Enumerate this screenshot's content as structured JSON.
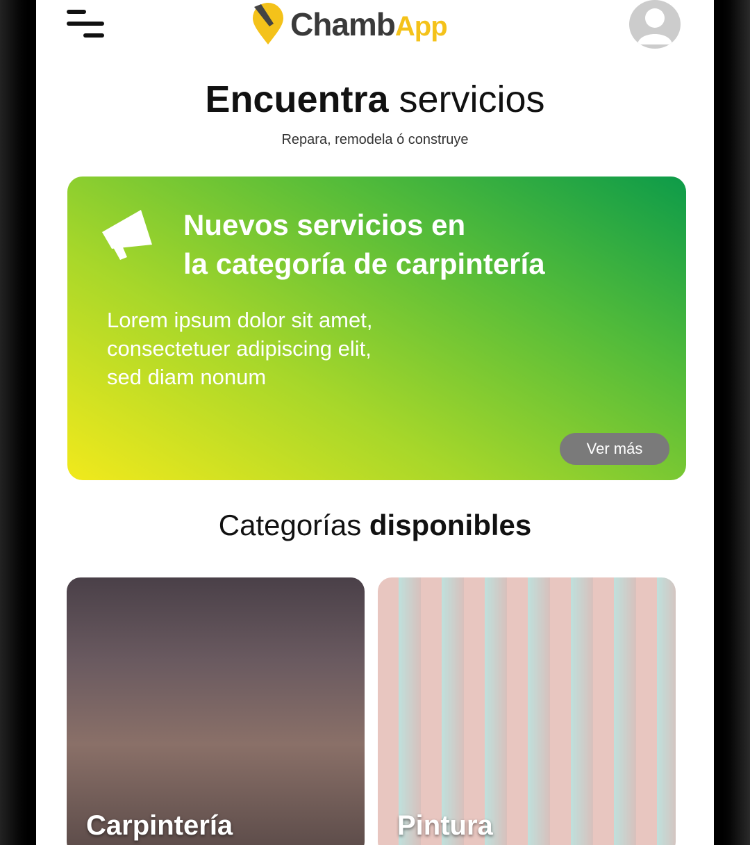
{
  "app": {
    "logo_main": "Chamb",
    "logo_accent": "App"
  },
  "header": {
    "title_bold": "Encuentra",
    "title_light": "servicios",
    "subtitle": "Repara, remodela ó construye"
  },
  "banner": {
    "headline_line1": "Nuevos servicios en",
    "headline_line2": "la categoría de carpintería",
    "body_line1": "Lorem ipsum dolor sit amet,",
    "body_line2": "consectetuer adipiscing elit,",
    "body_line3": "sed diam nonum",
    "button": "Ver más"
  },
  "categories": {
    "title_light": "Categorías",
    "title_bold": "disponibles",
    "items": [
      {
        "label": "Carpintería"
      },
      {
        "label": "Pintura"
      }
    ]
  },
  "colors": {
    "brand_yellow": "#f4c21a",
    "banner_start": "#f1e91c",
    "banner_end": "#0d9b49"
  }
}
